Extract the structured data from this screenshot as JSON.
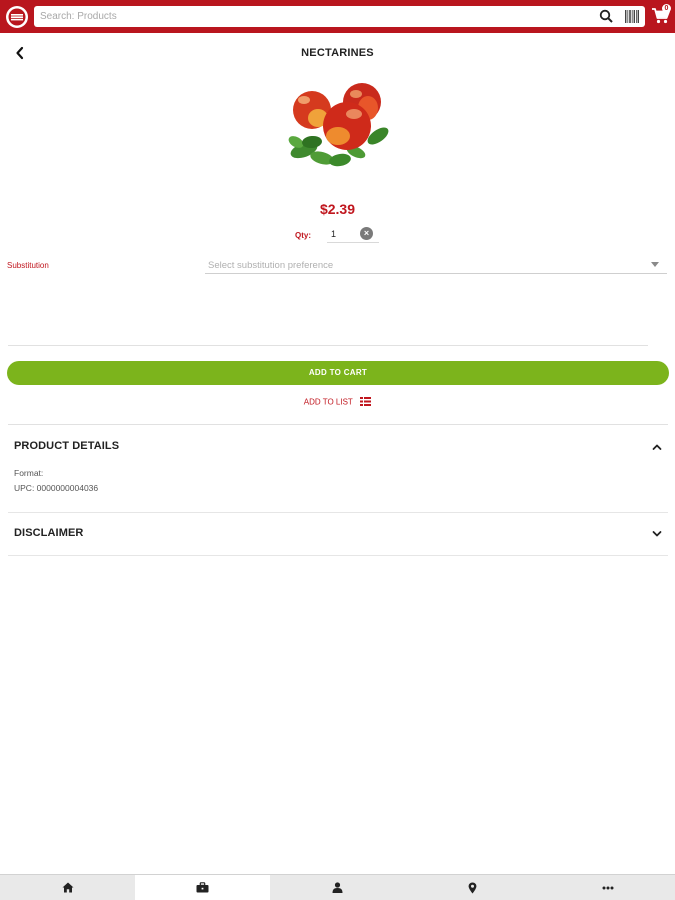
{
  "topbar": {
    "search_placeholder": "Search: Products",
    "cart_count": "0",
    "colors": {
      "brand": "#b9161e"
    }
  },
  "header": {
    "title": "NECTARINES"
  },
  "product": {
    "image_icon": "nectarines-image",
    "price": "$2.39",
    "qty_label": "Qty:",
    "qty_value": "1",
    "substitution_label": "Substitution",
    "substitution_placeholder": "Select substitution preference"
  },
  "actions": {
    "add_to_cart": "ADD TO CART",
    "add_to_list": "ADD TO LIST",
    "colors": {
      "cart_button": "#7cb41c",
      "accent": "#c0161e"
    }
  },
  "sections": {
    "details_title": "PRODUCT DETAILS",
    "format_line": "Format:",
    "upc_line": "UPC: 0000000004036",
    "disclaimer_title": "DISCLAIMER"
  },
  "bottom_nav": {
    "items": [
      "home-icon",
      "briefcase-icon",
      "user-icon",
      "map-pin-icon",
      "more-icon"
    ],
    "active": "briefcase-icon"
  }
}
